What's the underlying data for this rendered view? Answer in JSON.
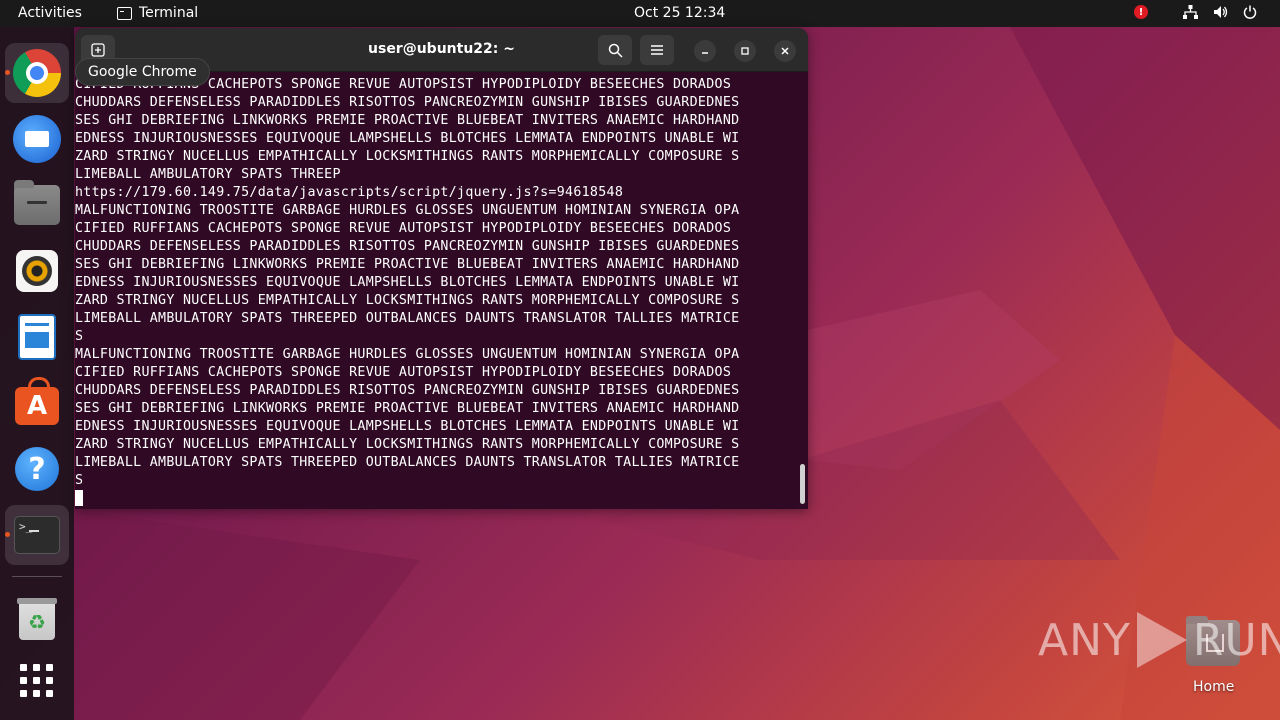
{
  "topbar": {
    "activities": "Activities",
    "app_name": "Terminal",
    "clock": "Oct 25  12:34",
    "icons": [
      "alert-icon",
      "network-icon",
      "volume-icon",
      "power-icon"
    ]
  },
  "dock": {
    "tooltip": "Google Chrome",
    "items": [
      {
        "name": "chrome-icon",
        "running": true
      },
      {
        "name": "thunderbird-icon",
        "running": false
      },
      {
        "name": "files-icon",
        "running": false
      },
      {
        "name": "rhythmbox-icon",
        "running": false
      },
      {
        "name": "libreoffice-writer-icon",
        "running": false
      },
      {
        "name": "software-store-icon",
        "running": false
      },
      {
        "name": "help-icon",
        "running": false
      },
      {
        "name": "terminal-icon",
        "running": true
      },
      {
        "name": "trash-icon",
        "running": false
      },
      {
        "name": "show-apps-icon",
        "running": false
      }
    ]
  },
  "terminal": {
    "title": "user@ubuntu22: ~",
    "lines": [
      "CIFIED RUFFIANS CACHEPOTS SPONGE REVUE AUTOPSIST HYPODIPLOIDY BESEECHES DORADOS",
      "CHUDDARS DEFENSELESS PARADIDDLES RISOTTOS PANCREOZYMIN GUNSHIP IBISES GUARDEDNES",
      "SES GHI DEBRIEFING LINKWORKS PREMIE PROACTIVE BLUEBEAT INVITERS ANAEMIC HARDHAND",
      "EDNESS INJURIOUSNESSES EQUIVOQUE LAMPSHELLS BLOTCHES LEMMATA ENDPOINTS UNABLE WI",
      "ZARD STRINGY NUCELLUS EMPATHICALLY LOCKSMITHINGS RANTS MORPHEMICALLY COMPOSURE S",
      "LIMEBALL AMBULATORY SPATS THREEP",
      "https://179.60.149.75/data/javascripts/script/jquery.js?s=94618548",
      "MALFUNCTIONING TROOSTITE GARBAGE HURDLES GLOSSES UNGUENTUM HOMINIAN SYNERGIA OPA",
      "CIFIED RUFFIANS CACHEPOTS SPONGE REVUE AUTOPSIST HYPODIPLOIDY BESEECHES DORADOS",
      "CHUDDARS DEFENSELESS PARADIDDLES RISOTTOS PANCREOZYMIN GUNSHIP IBISES GUARDEDNES",
      "SES GHI DEBRIEFING LINKWORKS PREMIE PROACTIVE BLUEBEAT INVITERS ANAEMIC HARDHAND",
      "EDNESS INJURIOUSNESSES EQUIVOQUE LAMPSHELLS BLOTCHES LEMMATA ENDPOINTS UNABLE WI",
      "ZARD STRINGY NUCELLUS EMPATHICALLY LOCKSMITHINGS RANTS MORPHEMICALLY COMPOSURE S",
      "LIMEBALL AMBULATORY SPATS THREEPED OUTBALANCES DAUNTS TRANSLATOR TALLIES MATRICE",
      "S",
      "MALFUNCTIONING TROOSTITE GARBAGE HURDLES GLOSSES UNGUENTUM HOMINIAN SYNERGIA OPA",
      "CIFIED RUFFIANS CACHEPOTS SPONGE REVUE AUTOPSIST HYPODIPLOIDY BESEECHES DORADOS",
      "CHUDDARS DEFENSELESS PARADIDDLES RISOTTOS PANCREOZYMIN GUNSHIP IBISES GUARDEDNES",
      "SES GHI DEBRIEFING LINKWORKS PREMIE PROACTIVE BLUEBEAT INVITERS ANAEMIC HARDHAND",
      "EDNESS INJURIOUSNESSES EQUIVOQUE LAMPSHELLS BLOTCHES LEMMATA ENDPOINTS UNABLE WI",
      "ZARD STRINGY NUCELLUS EMPATHICALLY LOCKSMITHINGS RANTS MORPHEMICALLY COMPOSURE S",
      "LIMEBALL AMBULATORY SPATS THREEPED OUTBALANCES DAUNTS TRANSLATOR TALLIES MATRICE",
      "S"
    ]
  },
  "desktop": {
    "home_label": "Home",
    "watermark_left": "ANY",
    "watermark_right": "RUN"
  },
  "colors": {
    "terminal_bg": "#300a24",
    "topbar_bg": "#1a1a1a",
    "accent": "#e95420"
  }
}
